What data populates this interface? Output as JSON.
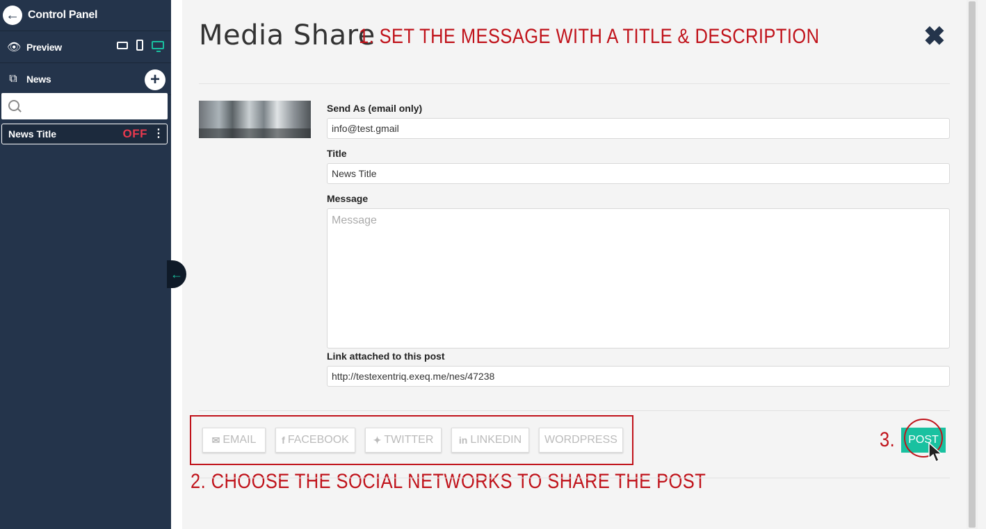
{
  "sidebar": {
    "title": "Control Panel",
    "preview_label": "Preview",
    "news_label": "News",
    "search": {
      "placeholder": "",
      "value": ""
    },
    "items": [
      {
        "title": "News Title",
        "status": "OFF"
      }
    ]
  },
  "main": {
    "title": "Media Share",
    "annotations": {
      "step1": "1. SET THE MESSAGE WITH A TITLE & DESCRIPTION",
      "step2": "2. CHOOSE THE SOCIAL NETWORKS TO SHARE THE POST",
      "step3": "3."
    },
    "form": {
      "send_as_label": "Send As (email only)",
      "send_as_value": "info@test.gmail",
      "title_label": "Title",
      "title_value": "News Title",
      "message_label": "Message",
      "message_placeholder": "Message",
      "link_label": "Link attached to this post",
      "link_value": "http://testexentriq.exeq.me/nes/47238"
    },
    "social": {
      "email": "EMAIL",
      "facebook": "FACEBOOK",
      "twitter": "TWITTER",
      "linkedin": "LINKEDIN",
      "wordpress": "WORDPRESS"
    },
    "post_label": "POST"
  },
  "colors": {
    "sidebar_bg": "#24344b",
    "accent": "#19c1a0",
    "annotation": "#c0121a",
    "status_off": "#e8394e"
  },
  "icons": [
    "back-arrow-icon",
    "eye-icon",
    "tablet-icon",
    "phone-icon",
    "desktop-icon",
    "news-icon",
    "add-icon",
    "search-icon",
    "kebab-icon",
    "close-icon",
    "envelope-icon",
    "facebook-icon",
    "twitter-icon",
    "linkedin-icon",
    "collapse-arrow-icon",
    "cursor-icon"
  ]
}
